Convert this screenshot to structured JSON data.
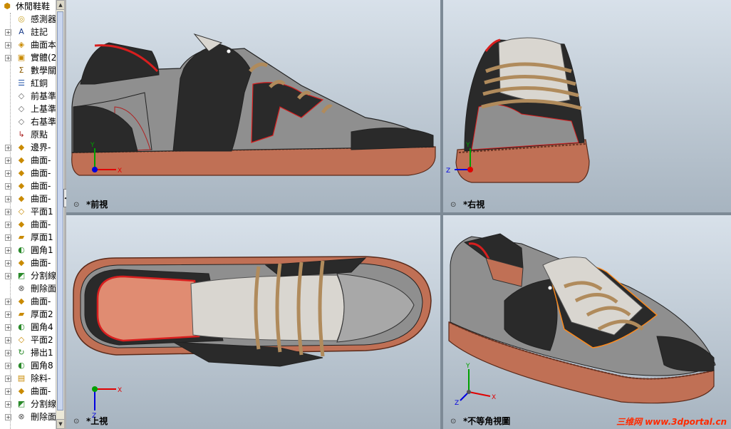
{
  "feature_tree": {
    "root_label": "休閒鞋鞋",
    "items": [
      {
        "label": "感測器",
        "icon": "sensor-icon",
        "expand": false
      },
      {
        "label": "註記",
        "icon": "annotation-icon",
        "expand": true
      },
      {
        "label": "曲面本",
        "icon": "surface-body-icon",
        "expand": true
      },
      {
        "label": "實體(2",
        "icon": "solid-body-icon",
        "expand": true
      },
      {
        "label": "數學關",
        "icon": "equation-icon",
        "expand": false
      },
      {
        "label": "紅銅",
        "icon": "material-icon",
        "expand": false
      },
      {
        "label": "前基準",
        "icon": "plane-icon",
        "expand": false
      },
      {
        "label": "上基準",
        "icon": "plane-icon",
        "expand": false
      },
      {
        "label": "右基準",
        "icon": "plane-icon",
        "expand": false
      },
      {
        "label": "原點",
        "icon": "origin-icon",
        "expand": false
      },
      {
        "label": "邊界-",
        "icon": "boundary-icon",
        "expand": true
      },
      {
        "label": "曲面-",
        "icon": "surface-icon",
        "expand": true
      },
      {
        "label": "曲面-",
        "icon": "surface-icon",
        "expand": true
      },
      {
        "label": "曲面-",
        "icon": "surface-icon",
        "expand": true
      },
      {
        "label": "曲面-",
        "icon": "surface-icon",
        "expand": true
      },
      {
        "label": "平面1",
        "icon": "plane-surface-icon",
        "expand": true
      },
      {
        "label": "曲面-",
        "icon": "surface-icon",
        "expand": true
      },
      {
        "label": "厚面1",
        "icon": "thicken-icon",
        "expand": true
      },
      {
        "label": "圓角1",
        "icon": "fillet-icon",
        "expand": true
      },
      {
        "label": "曲面-",
        "icon": "surface-icon",
        "expand": true
      },
      {
        "label": "分割線",
        "icon": "split-line-icon",
        "expand": true
      },
      {
        "label": "刪除面",
        "icon": "delete-face-icon",
        "expand": false
      },
      {
        "label": "曲面-",
        "icon": "surface-icon",
        "expand": true
      },
      {
        "label": "厚面2",
        "icon": "thicken-icon",
        "expand": true
      },
      {
        "label": "圓角4",
        "icon": "fillet-icon",
        "expand": true
      },
      {
        "label": "平面2",
        "icon": "plane-surface-icon",
        "expand": true
      },
      {
        "label": "掃出1",
        "icon": "sweep-icon",
        "expand": true
      },
      {
        "label": "圓角8",
        "icon": "fillet-icon",
        "expand": true
      },
      {
        "label": "除料-",
        "icon": "cut-icon",
        "expand": true
      },
      {
        "label": "曲面-",
        "icon": "surface-icon",
        "expand": true
      },
      {
        "label": "分割線",
        "icon": "split-line-icon",
        "expand": true
      },
      {
        "label": "刪除面",
        "icon": "delete-face-icon",
        "expand": true
      }
    ]
  },
  "viewports": {
    "front": {
      "label": "*前視"
    },
    "right": {
      "label": "*右視"
    },
    "top": {
      "label": "*上視"
    },
    "iso": {
      "label": "*不等角視圖"
    }
  },
  "axes": {
    "x": "X",
    "y": "Y",
    "z": "Z"
  },
  "watermark": {
    "chinese": "三维网",
    "url": "www.3dportal.cn"
  },
  "colors": {
    "sole": "#c07055",
    "upper_black": "#2a2a2a",
    "upper_grey": "#8f8f8f",
    "tongue": "#d9d6d0",
    "lace": "#b08b5c",
    "collar_red": "#d81e1e",
    "inner_lining": "#e08c72",
    "axis_x": "#e00000",
    "axis_y": "#00a000",
    "axis_z": "#0000e0"
  }
}
